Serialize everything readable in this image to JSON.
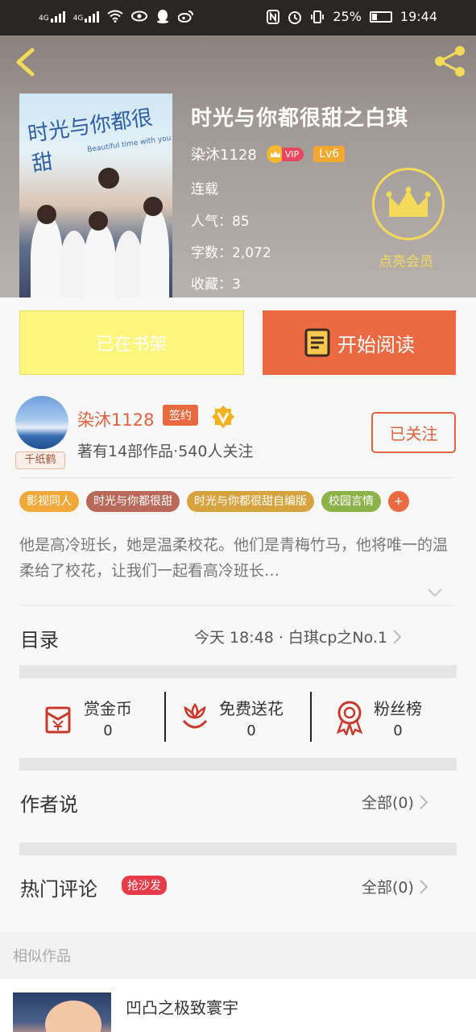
{
  "status_bar": {
    "network_left": "4G",
    "network_right": "4G",
    "battery": "25%",
    "time": "19:44"
  },
  "book": {
    "title": "时光与你都很甜之白琪",
    "author": "染沐1128",
    "vip_label": "VIP",
    "level": "Lv6",
    "status": "连载",
    "popularity_label": "人气：",
    "popularity": "85",
    "words_label": "字数：",
    "words": "2,072",
    "favorites_label": "收藏：",
    "favorites": "3",
    "member_label": "点亮会员",
    "cover_title": "时光与你都很甜",
    "cover_subtitle": "Beautiful time with you"
  },
  "actions": {
    "shelf": "已在书架",
    "read": "开始阅读"
  },
  "author": {
    "name": "染沐1128",
    "sign_badge": "签约",
    "frame_badge": "千纸鹤",
    "stats": "著有14部作品·540人关注",
    "follow": "已关注"
  },
  "tags": [
    {
      "label": "影视同人",
      "color": "#f0a93a"
    },
    {
      "label": "时光与你都很甜",
      "color": "#b8695a"
    },
    {
      "label": "时光与你都很甜自编版",
      "color": "#d6a33e"
    },
    {
      "label": "校园言情",
      "color": "#8cb24a"
    },
    {
      "label": "+",
      "color": "#ec6a42"
    }
  ],
  "description": "他是高冷班长，她是温柔校花。他们是青梅竹马，他将唯一的温柔给了校花，让我们一起看高冷班长…",
  "catalog": {
    "title": "目录",
    "latest": "今天 18:48 · 白琪cp之No.1"
  },
  "stats": [
    {
      "label": "赏金币",
      "value": "0",
      "icon": "red-envelope-icon"
    },
    {
      "label": "免费送花",
      "value": "0",
      "icon": "flower-icon"
    },
    {
      "label": "粉丝榜",
      "value": "0",
      "icon": "medal-icon"
    }
  ],
  "author_says": {
    "title": "作者说",
    "all": "全部(0)"
  },
  "hot_comments": {
    "title": "热门评论",
    "badge": "抢沙发",
    "all": "全部(0)"
  },
  "similar": {
    "heading": "相似作品",
    "first_title": "凹凸之极致寰宇"
  }
}
